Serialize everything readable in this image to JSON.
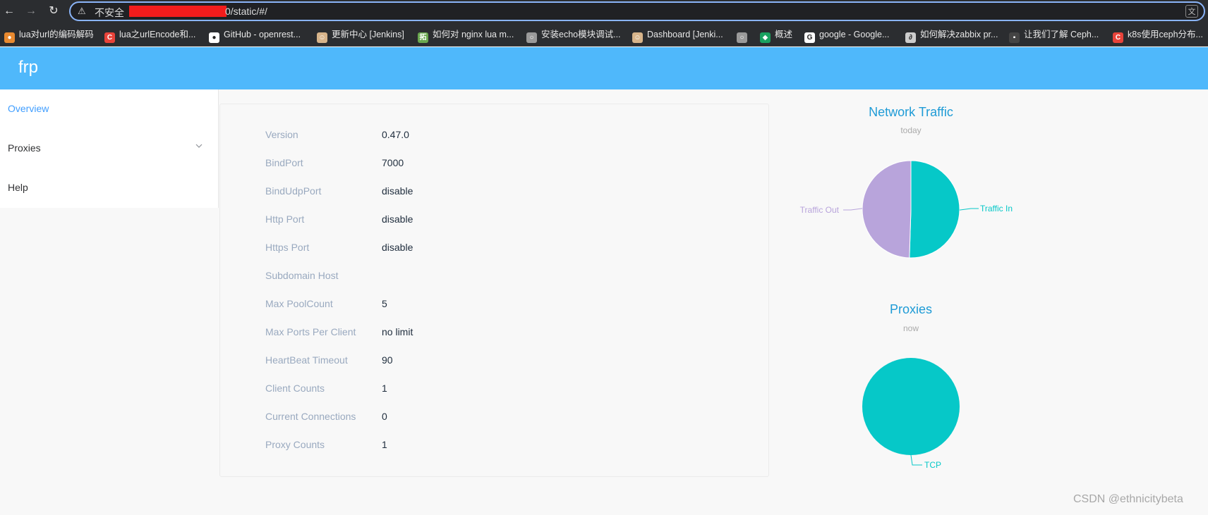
{
  "browser": {
    "security_label": "不安全",
    "url_visible": "0/static/#/"
  },
  "bookmarks": [
    {
      "label": "lua对url的编码解码",
      "icon": "orange-swirl-icon",
      "color": "#e8892f"
    },
    {
      "label": "lua之urlEncode和...",
      "icon": "csdn-icon",
      "color": "#e8433a"
    },
    {
      "label": "GitHub - openrest...",
      "icon": "github-icon",
      "color": "#ffffff"
    },
    {
      "label": "更新中心 [Jenkins]",
      "icon": "jenkins-icon",
      "color": "#d7b48a"
    },
    {
      "label": "如何对 nginx lua m...",
      "icon": "green-square-icon",
      "color": "#6aa84f"
    },
    {
      "label": "安装echo模块调试...",
      "icon": "globe-icon",
      "color": "#9a9a9a"
    },
    {
      "label": "Dashboard [Jenki...",
      "icon": "jenkins-icon",
      "color": "#d7b48a"
    },
    {
      "label": "",
      "icon": "globe-icon",
      "color": "#9a9a9a"
    },
    {
      "label": "概述",
      "icon": "green-leaf-icon",
      "color": "#1aa260"
    },
    {
      "label": "google - Google...",
      "icon": "google-icon",
      "color": "#ffffff"
    },
    {
      "label": "如何解决zabbix pr...",
      "icon": "zabbix-icon",
      "color": "#cccccc"
    },
    {
      "label": "让我们了解 Ceph...",
      "icon": "dark-icon",
      "color": "#444444"
    },
    {
      "label": "k8s使用ceph分布...",
      "icon": "csdn-icon",
      "color": "#e8433a"
    }
  ],
  "app": {
    "logo": "frp"
  },
  "sidebar": {
    "items": [
      {
        "label": "Overview",
        "active": true
      },
      {
        "label": "Proxies",
        "active": false,
        "expandable": true
      },
      {
        "label": "Help",
        "active": false
      }
    ]
  },
  "overview": {
    "rows": [
      {
        "key": "Version",
        "value": "0.47.0"
      },
      {
        "key": "BindPort",
        "value": "7000"
      },
      {
        "key": "BindUdpPort",
        "value": "disable"
      },
      {
        "key": "Http Port",
        "value": "disable"
      },
      {
        "key": "Https Port",
        "value": "disable"
      },
      {
        "key": "Subdomain Host",
        "value": ""
      },
      {
        "key": "Max PoolCount",
        "value": "5"
      },
      {
        "key": "Max Ports Per Client",
        "value": "no limit"
      },
      {
        "key": "HeartBeat Timeout",
        "value": "90"
      },
      {
        "key": "Client Counts",
        "value": "1"
      },
      {
        "key": "Current Connections",
        "value": "0"
      },
      {
        "key": "Proxy Counts",
        "value": "1"
      }
    ]
  },
  "chart_data": [
    {
      "type": "pie",
      "title": "Network Traffic",
      "subtitle": "today",
      "slices": [
        {
          "name": "Traffic In",
          "value": 50.5,
          "color": "#06c8c8"
        },
        {
          "name": "Traffic Out",
          "value": 49.5,
          "color": "#b8a4db"
        }
      ]
    },
    {
      "type": "pie",
      "title": "Proxies",
      "subtitle": "now",
      "slices": [
        {
          "name": "TCP",
          "value": 1,
          "color": "#06c8c8"
        }
      ]
    }
  ],
  "watermark": "CSDN @ethnicitybeta"
}
